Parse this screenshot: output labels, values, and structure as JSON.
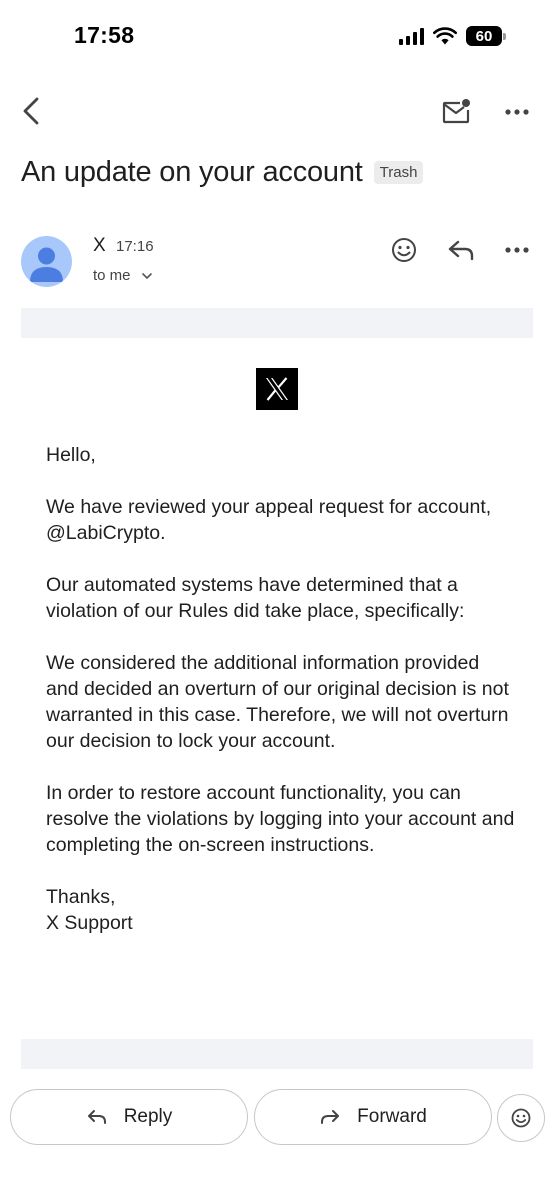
{
  "status_bar": {
    "time": "17:58",
    "battery": "60"
  },
  "toolbar": {
    "back_icon": "chevron-left-icon",
    "mail_icon": "mark-unread-icon",
    "more_icon": "more-vert-icon"
  },
  "email": {
    "subject": "An update on your account",
    "label": "Trash",
    "sender": "X",
    "time": "17:16",
    "recipient": "to me",
    "body": {
      "greeting": "Hello,",
      "p1": "We have reviewed your appeal request for account, @LabiCrypto.",
      "p2": "Our automated systems have determined that a violation of our Rules did take place, specifically:",
      "p3": "We considered the additional information provided and decided an overturn of our original decision is not warranted in this case. Therefore, we will not overturn our decision to lock your account.",
      "p4": "In order to restore account functionality, you can resolve the violations by logging into your account and completing the on-screen instructions.",
      "closing": "Thanks,",
      "signature": "X Support"
    }
  },
  "actions": {
    "reply_label": "Reply",
    "forward_label": "Forward"
  },
  "colors": {
    "avatar_bg": "#a8c7fa",
    "avatar_fg": "#4285f4",
    "band": "#f1f3f6",
    "logo_bg": "#000000"
  }
}
